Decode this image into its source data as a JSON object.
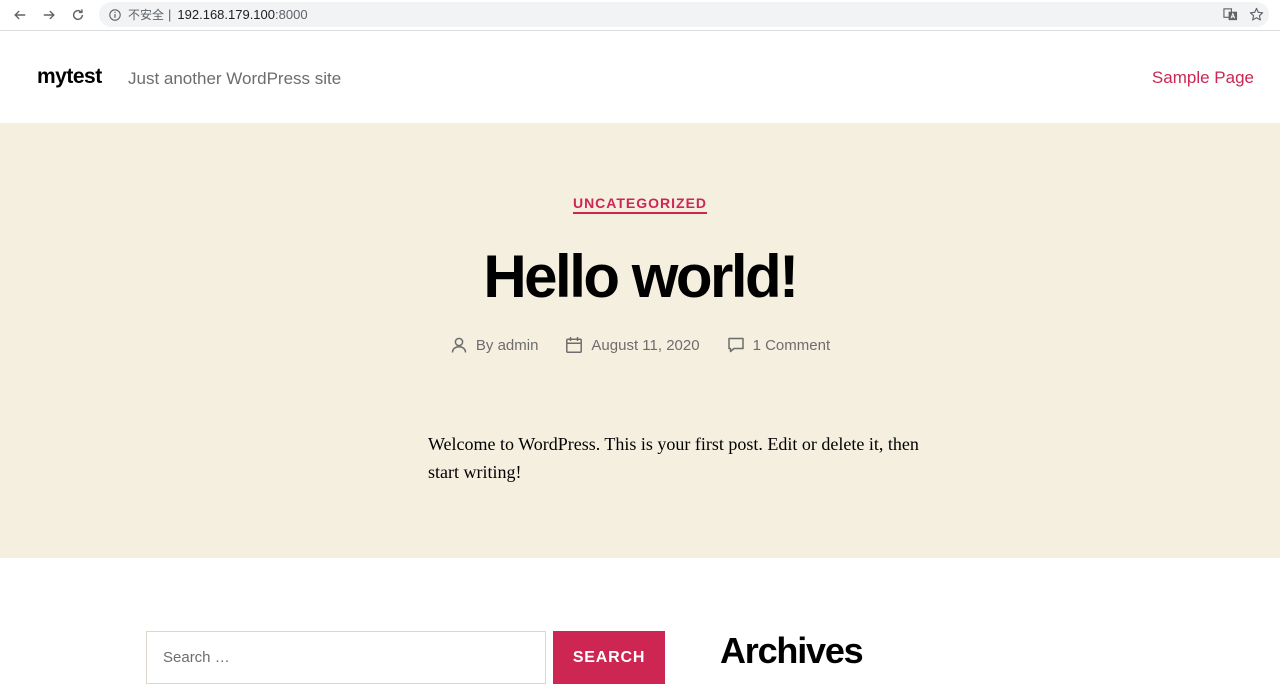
{
  "browser": {
    "security_label": "不安全",
    "divider": "|",
    "url_host": "192.168.179.100",
    "url_port": ":8000"
  },
  "site": {
    "title": "mytest",
    "description": "Just another WordPress site",
    "menu": [
      "Sample Page"
    ]
  },
  "post": {
    "category": "UNCATEGORIZED",
    "title": "Hello world!",
    "author": "By admin",
    "date": "August 11, 2020",
    "comments": "1 Comment",
    "content": "Welcome to WordPress. This is your first post. Edit or delete it, then start writing!"
  },
  "widgets": {
    "search_placeholder": "Search …",
    "search_button": "SEARCH",
    "archives_title": "Archives"
  },
  "colors": {
    "accent": "#cd2653",
    "hero_background": "#f5efe0",
    "secondary_text": "#6d6d6d"
  }
}
